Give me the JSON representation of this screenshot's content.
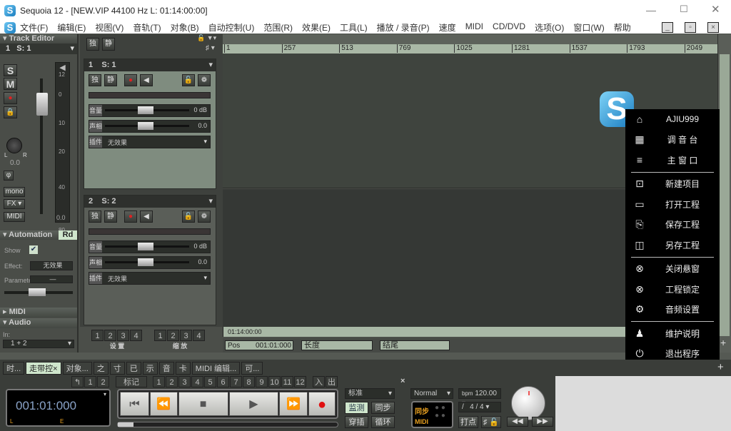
{
  "window": {
    "title": "Sequoia 12 - [NEW.VIP   44100 Hz L: 01:14:00:00]",
    "logo": "S"
  },
  "menu": [
    "文件(F)",
    "编辑(E)",
    "视图(V)",
    "音轨(T)",
    "对象(B)",
    "自动控制(U)",
    "范围(R)",
    "效果(E)",
    "工具(L)",
    "播放 / 录音(P)",
    "速度",
    "MIDI",
    "CD/DVD",
    "选项(O)",
    "窗口(W)",
    "帮助"
  ],
  "left": {
    "header": "Track Editor",
    "track_no": "1",
    "track_name": "S: 1",
    "s": "S",
    "m": "M",
    "pan_l": "L",
    "pan_r": "R",
    "pan_value": "0.0",
    "phase": "φ",
    "mono": "mono",
    "fx": "FX",
    "midi": "MIDI",
    "meter_scale": [
      "12",
      "0",
      "10",
      "20",
      "40",
      "80"
    ],
    "meter_value": "0.0",
    "automation": {
      "title": "Automation",
      "rd": "Rd",
      "show_label": "Show",
      "show_checked": true,
      "effect_label": "Effect:",
      "effect_value": "无效果",
      "param_label": "Parameter",
      "param_value": "—"
    },
    "midi_title": "MIDI",
    "audio_title": "Audio",
    "in_label": "In:",
    "in_value": "1 + 2"
  },
  "toolbar": {
    "solo": "独",
    "mute": "静"
  },
  "ruler": [
    "1",
    "257",
    "513",
    "769",
    "1025",
    "1281",
    "1537",
    "1793",
    "2049"
  ],
  "tracks": [
    {
      "no": "1",
      "name": "S: 1",
      "solo": "独",
      "mute": "静",
      "vol_label": "音量",
      "vol_value": "0 dB",
      "pan_label": "声相",
      "pan_value": "0.0",
      "plug_label": "插件",
      "plug_value": "无效果"
    },
    {
      "no": "2",
      "name": "S: 2",
      "solo": "独",
      "mute": "静",
      "vol_label": "音量",
      "vol_value": "0 dB",
      "pan_label": "声相",
      "pan_value": "0.0",
      "plug_label": "插件",
      "plug_value": "无效果"
    }
  ],
  "presets": {
    "buttons": [
      "1",
      "2",
      "3",
      "4"
    ],
    "setup": "设 置",
    "zoom": "缩 放"
  },
  "position": {
    "timecode": "01:14:00:00",
    "pos_label": "Pos",
    "pos_value": "001:01:000",
    "length_label": "长度",
    "end_label": "结尾"
  },
  "popup": {
    "items": [
      {
        "icon": "home",
        "label": "AJIU999"
      },
      {
        "icon": "mixer",
        "label": "调 音 台"
      },
      {
        "icon": "menu",
        "label": "主 窗 口"
      },
      {
        "icon": "new-project",
        "label": "新建项目"
      },
      {
        "icon": "folder",
        "label": "打开工程"
      },
      {
        "icon": "save",
        "label": "保存工程"
      },
      {
        "icon": "save-as",
        "label": "另存工程"
      },
      {
        "icon": "close-circle",
        "label": "关闭悬窗"
      },
      {
        "icon": "close-circle",
        "label": "工程锁定"
      },
      {
        "icon": "gear",
        "label": "音频设置"
      },
      {
        "icon": "qq",
        "label": "维护说明"
      },
      {
        "icon": "power",
        "label": "退出程序"
      }
    ]
  },
  "bottom_tabs": [
    "时...",
    "走带控",
    "对象...",
    "之",
    "寸",
    "已",
    "示",
    "音",
    "卡",
    "MIDI 编辑...",
    "可..."
  ],
  "markers": {
    "undo": "↰",
    "a": [
      "1",
      "2"
    ],
    "label": "标记",
    "nums": [
      "1",
      "2",
      "3",
      "4",
      "5",
      "6",
      "7",
      "8",
      "9",
      "10",
      "11",
      "12"
    ],
    "in": "入",
    "out": "出"
  },
  "transport": {
    "time": "001:01:000",
    "l": "L",
    "e": "E",
    "mode": "标准",
    "monitor": "监测",
    "sync": "同步",
    "punch": "穿插",
    "loop": "循环",
    "normal": "Normal",
    "bpm_label": "bpm",
    "bpm": "120.00",
    "sig_prefix": "/",
    "sig": "4 / 4",
    "sync_label": "同步",
    "midi_label": "MIDI",
    "in": "入",
    "out": "出",
    "tap": "打点",
    "grid": "♯"
  },
  "colors": {
    "ruler": "#a9b8a6",
    "track1": "#7f8c7f",
    "popup": "#000000",
    "record": "#e01010"
  }
}
